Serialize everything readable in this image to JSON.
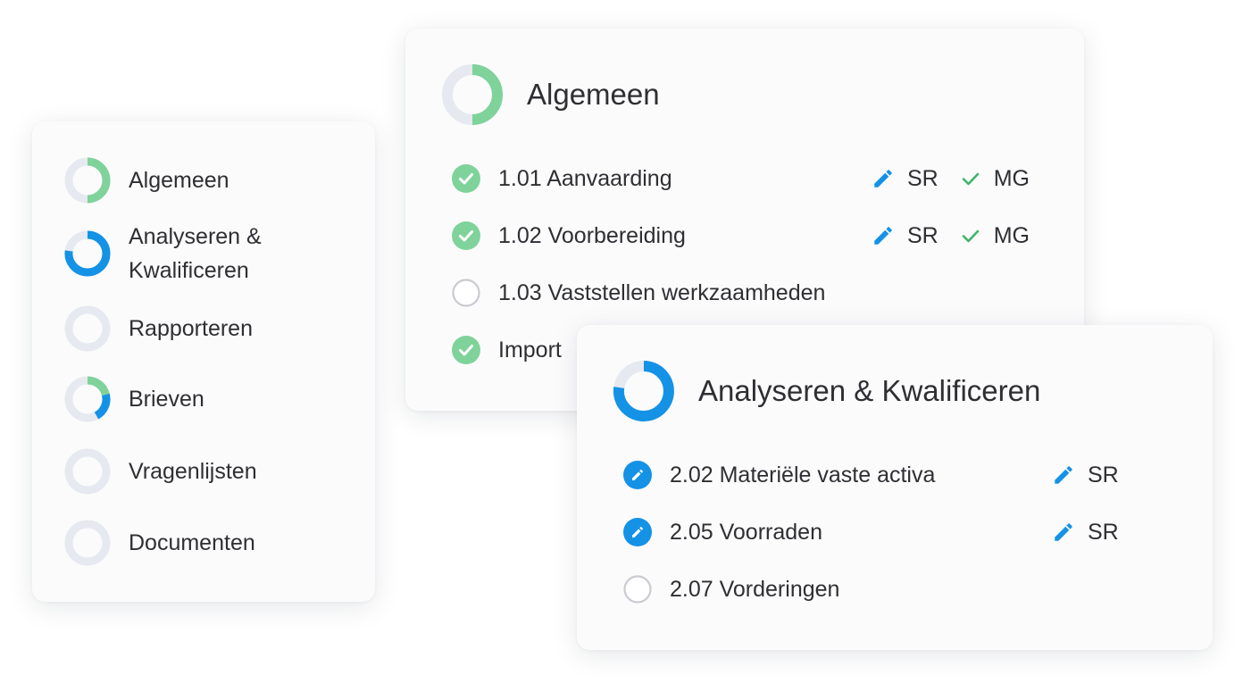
{
  "colors": {
    "green": "#7fd39a",
    "blue": "#1492e6",
    "ring_track": "#e6e9ef",
    "empty_circle": "#c9cbd0",
    "text": "#2f2f33"
  },
  "sidebar": {
    "items": [
      {
        "label": "Algemeen",
        "ring": "half-green"
      },
      {
        "label": "Analyseren &\nKwalificeren",
        "ring": "blue-most"
      },
      {
        "label": "Rapporteren",
        "ring": "empty"
      },
      {
        "label": "Brieven",
        "ring": "green-blue"
      },
      {
        "label": "Vragenlijsten",
        "ring": "empty"
      },
      {
        "label": "Documenten",
        "ring": "empty"
      }
    ]
  },
  "algemeen": {
    "title": "Algemeen",
    "progress": 0.5,
    "tasks": [
      {
        "label": "1.01 Aanvaarding",
        "status": "done",
        "editor": "SR",
        "reviewer": "MG"
      },
      {
        "label": "1.02 Voorbereiding",
        "status": "done",
        "editor": "SR",
        "reviewer": "MG"
      },
      {
        "label": "1.03 Vaststellen werkzaamheden",
        "status": "open"
      },
      {
        "label": "Import",
        "status": "done"
      }
    ]
  },
  "analyseren": {
    "title": "Analyseren & Kwalificeren",
    "progress": 0.78,
    "tasks": [
      {
        "label": "2.02 Materiële vaste activa",
        "status": "editing",
        "editor": "SR"
      },
      {
        "label": "2.05 Voorraden",
        "status": "editing",
        "editor": "SR"
      },
      {
        "label": "2.07 Vorderingen",
        "status": "open"
      }
    ]
  }
}
